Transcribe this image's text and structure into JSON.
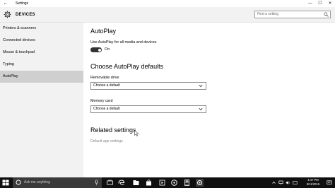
{
  "window": {
    "back_icon": "back-arrow-icon",
    "title": "Settings",
    "minimize": "—",
    "maximize": "☐",
    "close": "✕"
  },
  "header": {
    "section": "DEVICES",
    "icon": "gear-icon",
    "search_placeholder": "Find a setting"
  },
  "sidebar": {
    "items": [
      {
        "label": "Printers & scanners"
      },
      {
        "label": "Connected devices"
      },
      {
        "label": "Mouse & touchpad"
      },
      {
        "label": "Typing"
      },
      {
        "label": "AutoPlay"
      }
    ],
    "active_index": 4
  },
  "main": {
    "title": "AutoPlay",
    "toggle_caption": "Use AutoPlay for all media and devices",
    "toggle_state": "On",
    "defaults_heading": "Choose AutoPlay defaults",
    "removable_label": "Removable drive",
    "removable_value": "Choose a default",
    "memory_label": "Memory card",
    "memory_value": "Choose a default",
    "related_heading": "Related settings",
    "related_link": "Default app settings"
  },
  "taskbar": {
    "search_text": "Ask me anything",
    "time": "4:47 PM",
    "date": "8/11/2015"
  },
  "colors": {
    "sidebar_bg": "#f2f2f2",
    "active_item_bg": "#cfcfcf",
    "taskbar_bg": "#101010",
    "toggle_on": "#333333",
    "link_gray": "#888888"
  }
}
